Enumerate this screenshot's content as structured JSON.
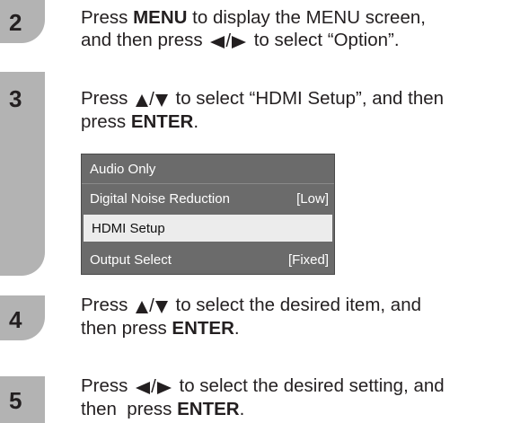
{
  "steps": [
    {
      "number": "2",
      "line1_a": "Press ",
      "line1_bold": "MENU",
      "line1_b": " to display the MENU screen,",
      "line2_a": "and then press ",
      "line2_b": " to select “Option”.",
      "arrow_icon": "left-right-triangle-icon"
    },
    {
      "number": "3",
      "line1_a": "Press ",
      "line1_b": " to select “HDMI Setup”, and then",
      "line2_a": "press ",
      "line2_bold": "ENTER",
      "line2_b": ".",
      "arrow_icon": "up-down-triangle-icon"
    },
    {
      "number": "4",
      "line1_a": "Press ",
      "line1_b": " to select the desired item, and",
      "line2_a": "then press ",
      "line2_bold": "ENTER",
      "line2_b": ".",
      "arrow_icon": "up-down-triangle-icon"
    },
    {
      "number": "5",
      "line1_a": "Press ",
      "line1_b": " to select the desired setting, and",
      "line2_a": "then  press ",
      "line2_bold": "ENTER",
      "line2_b": ".",
      "arrow_icon": "left-right-triangle-icon"
    }
  ],
  "arrow_separator": "/",
  "menu": {
    "items": [
      {
        "label": "Audio Only",
        "value": ""
      },
      {
        "label": "Digital Noise Reduction",
        "value": "[Low]"
      },
      {
        "label": "HDMI Setup",
        "value": "",
        "selected": true
      },
      {
        "label": "Output Select",
        "value": "[Fixed]"
      }
    ]
  },
  "colors": {
    "tab": "#b3b3b3",
    "menu_bg": "#6b6b6b",
    "menu_selected": "#ececec",
    "text": "#231f20"
  }
}
